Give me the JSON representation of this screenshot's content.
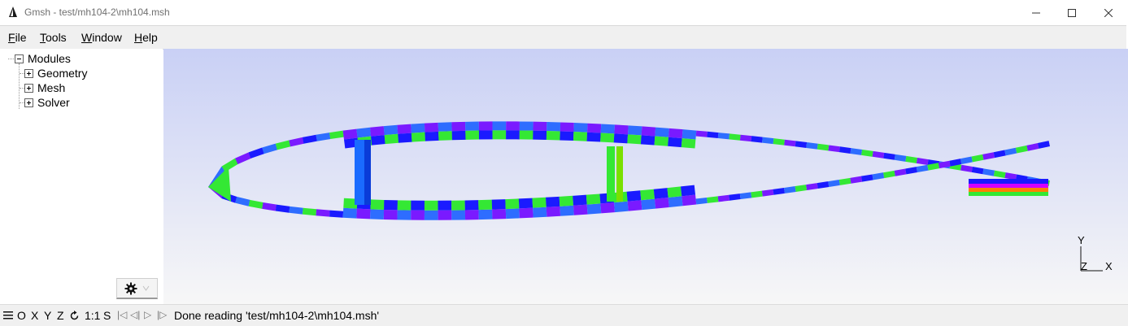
{
  "window": {
    "title": "Gmsh - test/mh104-2\\mh104.msh",
    "controls": [
      "minimize-icon",
      "maximize-icon",
      "close-icon"
    ]
  },
  "menubar": {
    "items": [
      {
        "underline": "F",
        "rest": "ile"
      },
      {
        "underline": "T",
        "rest": "ools"
      },
      {
        "underline": "W",
        "rest": "indow"
      },
      {
        "underline": "H",
        "rest": "elp"
      }
    ]
  },
  "tree": {
    "root": "Modules",
    "children": [
      "Geometry",
      "Mesh",
      "Solver"
    ]
  },
  "statusbar": {
    "x_label": "X",
    "y_label": "Y",
    "z_label": "Z",
    "o_label": "O",
    "scale_label": "1:1",
    "s_label": "S",
    "message": "Done reading 'test/mh104-2\\mh104.msh'"
  },
  "axes_triad": {
    "x": "X",
    "y": "Y",
    "z": "Z"
  },
  "colors": {
    "mesh_palette": [
      "#1a1aff",
      "#7a1aff",
      "#00e5ff",
      "#2e6dff",
      "#34e834",
      "#e8e800",
      "#ff8000",
      "#d400ff",
      "#00ff90",
      "#0099ff"
    ]
  }
}
